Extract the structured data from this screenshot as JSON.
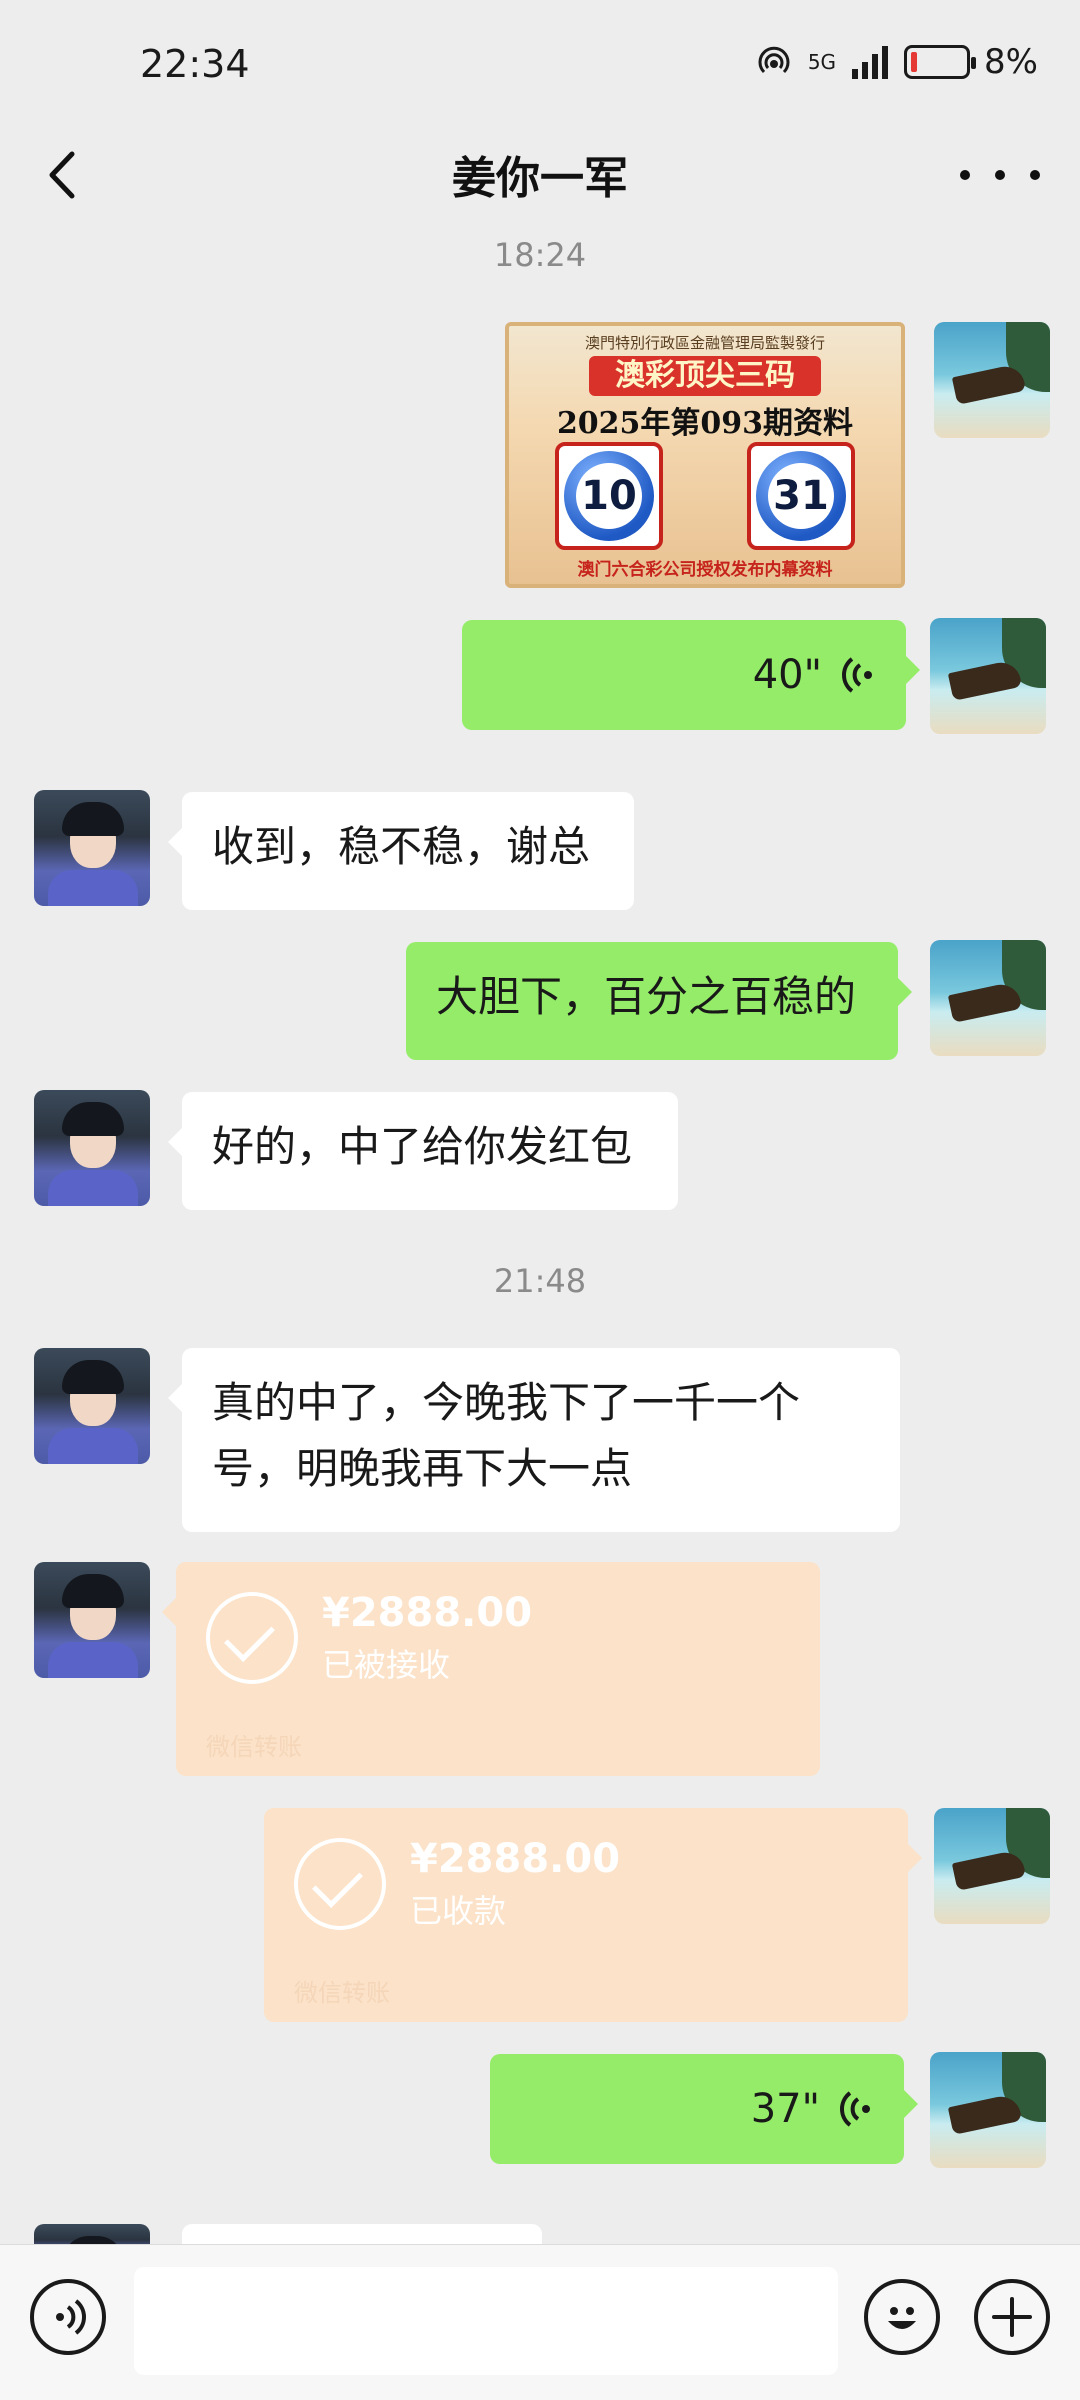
{
  "status_bar": {
    "time": "22:34",
    "network": "5G",
    "battery": "8%",
    "battery_level": 0.08
  },
  "nav": {
    "title": "姜你一军"
  },
  "messages": {
    "ts1": "18:24",
    "image": {
      "top_text": "澳門特別行政區金融管理局監製發行",
      "banner": "澳彩顶尖三码",
      "title": "2025年第093期资料",
      "ball1": "10",
      "ball2": "31",
      "bottom_text": "澳门六合彩公司授权发布内幕资料"
    },
    "voice1": "40\"",
    "in1": "收到，稳不稳，谢总",
    "out1": "大胆下，百分之百稳的",
    "in2": "好的，中了给你发红包",
    "ts2": "21:48",
    "in3": "真的中了，今晚我下了一千一个号，明晚我再下大一点",
    "transfer_in": {
      "amount": "¥2888.00",
      "status": "已被接收",
      "footer": "微信转账"
    },
    "transfer_out": {
      "amount": "¥2888.00",
      "status": "已收款",
      "footer": "微信转账"
    },
    "voice2": "37\""
  },
  "colors": {
    "outgoing": "#95EC69",
    "incoming": "#FFFFFF",
    "transfer": "#FBE2C8",
    "background": "#EDEDED"
  }
}
